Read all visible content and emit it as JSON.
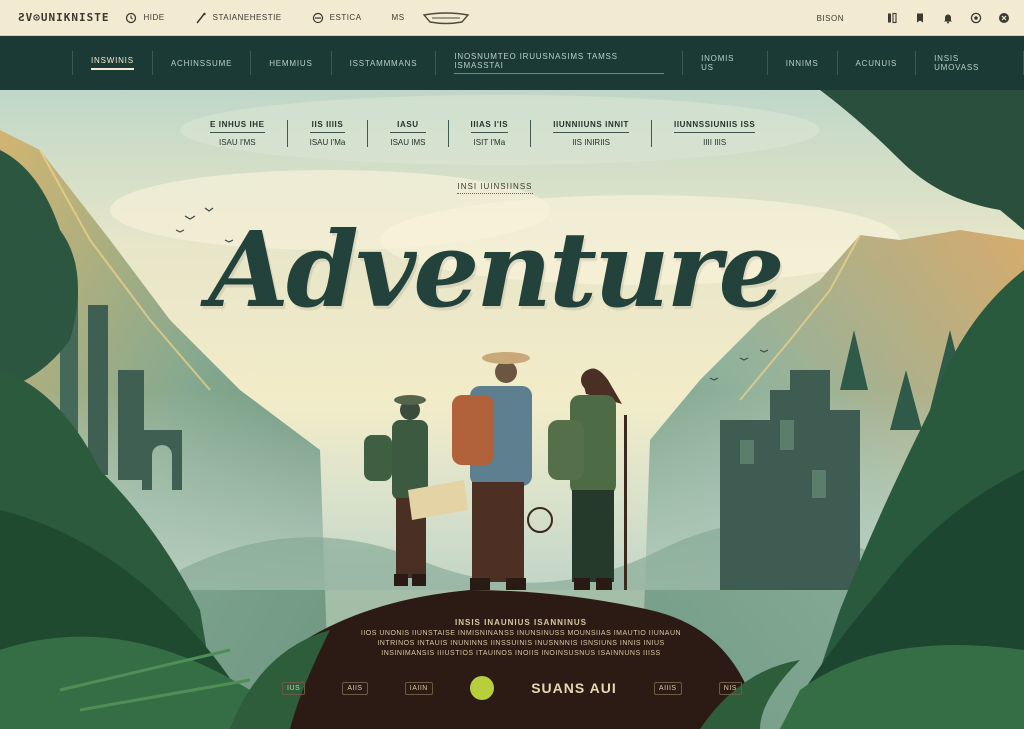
{
  "topbar": {
    "brand": "ƧV⊙UNIKNISTE",
    "util": [
      {
        "icon": "clock-icon",
        "label": "HIDE"
      },
      {
        "icon": "hiker-icon",
        "label": "STAIANEHESTIE"
      },
      {
        "icon": "globe-icon",
        "label": "ESTICA"
      },
      {
        "icon": "",
        "label": "MS"
      }
    ],
    "center_logo": "boat-logo-icon",
    "signin": "BISON",
    "right_icons": [
      "profile-icon",
      "bookmark-icon",
      "bell-icon",
      "settings-icon",
      "close-icon"
    ]
  },
  "nav": {
    "items": [
      {
        "label": "INSWINIS",
        "active": true
      },
      {
        "label": "ACHINSSUME"
      },
      {
        "label": "HEMMIUS"
      },
      {
        "label": "ISSTAMMMANS"
      },
      {
        "label": "INOSNUMTEO IRUUSNASIMS TAMSS ISMASSTAI",
        "wide": true
      },
      {
        "label": "INOMIS US"
      },
      {
        "label": "INNIMS"
      },
      {
        "label": "ACUNUIS"
      },
      {
        "label": "INSIS UMOVASS"
      }
    ]
  },
  "hero": {
    "stats": [
      {
        "label": "E INHUS IHE",
        "value": "ISAU I'MS"
      },
      {
        "label": "IIS IIIIS",
        "value": "ISAU I'Ma"
      },
      {
        "label": "IASU",
        "value": "ISAU IMS"
      },
      {
        "label": "IIIAS I'IS",
        "value": "ISIT I'Ma"
      },
      {
        "label": "IIUNNIIUNS INNIT",
        "value": "IIS INIRIIS"
      },
      {
        "label": "IIUNNSSIUNIIS ISS",
        "value": "IIII IIIS"
      }
    ],
    "kicker": "INSI IUINSIINSS",
    "title": "Adventure",
    "footer_head": "INSIS INAUNIUS ISANNINUS",
    "footer_lines": [
      "IIOS UNONIS IIUNSTAISE INMISNINANSS INUNSINUSS MOUNSIIAS IMAUTIO IIUNAUN",
      "INTRINOS INTAUIS INUNINNS IINSSUINIS INUSNNNIS ISNSIUNS INNIS INIUS",
      "INSINIMANSIS IIIUSTIOS ITAUINOS INOIIS INOINSUSNUS ISAINNUNS IIISS"
    ],
    "cta_minis": [
      "IUS",
      "AIIS",
      "IAIIN"
    ],
    "cta_label": "SUANS AUI",
    "cta_minis_right": [
      "AIIIS",
      "NIS"
    ],
    "colors": {
      "nav": "#1b3a36",
      "title": "#22423b",
      "accent_button": "#b7cf3a",
      "sky": "#f2ebc9",
      "jungle": "#1f4a34"
    }
  }
}
